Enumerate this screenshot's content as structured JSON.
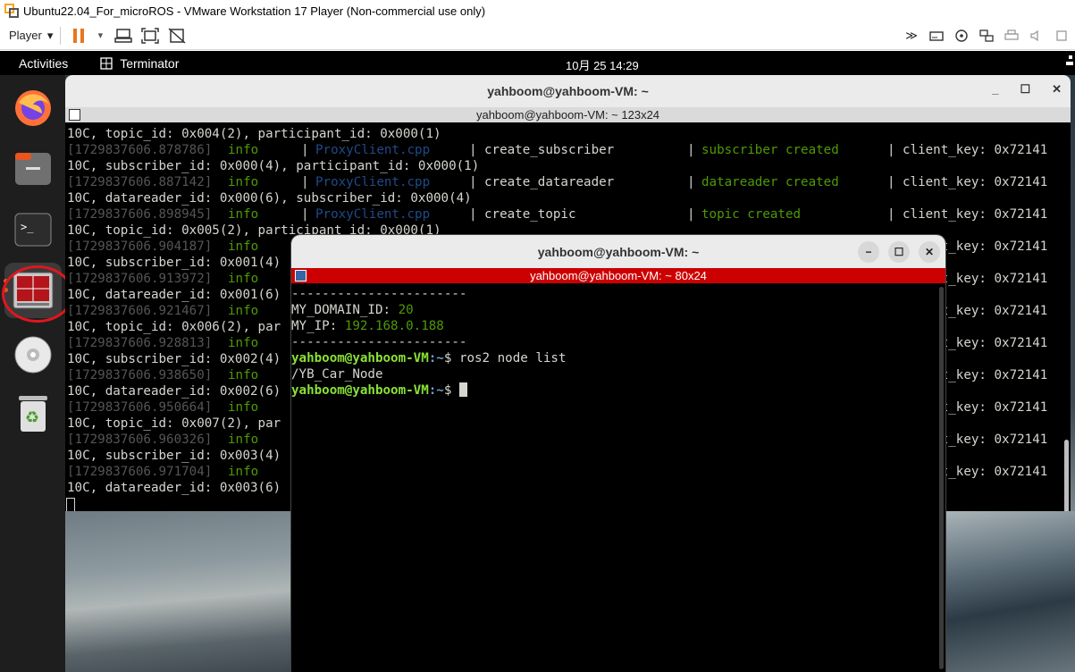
{
  "vmware": {
    "title": "Ubuntu22.04_For_microROS - VMware Workstation 17 Player (Non-commercial use only)",
    "player_label": "Player",
    "toolbar_icons": [
      "pause-icon",
      "chevron-down-icon",
      "send-ctrl-alt-del-icon",
      "fit-window-icon",
      "unity-icon"
    ],
    "tray_icons": [
      "forward-icon",
      "disk-icon",
      "cd-icon",
      "network-icon",
      "printer-icon",
      "audio-icon",
      "usb-icon"
    ]
  },
  "ubuntu_bar": {
    "activities": "Activities",
    "app_name": "Terminator",
    "clock": "10月 25  14:29"
  },
  "dock": {
    "items": [
      "firefox-icon",
      "files-icon",
      "terminal-icon",
      "terminator-icon",
      "cd-icon",
      "trash-icon"
    ],
    "active_item": "terminator-icon",
    "highlight_color": "#e0161e"
  },
  "big_terminal": {
    "title": "yahboom@yahboom-VM: ~",
    "subtitle": "yahboom@yahboom-VM: ~ 123x24",
    "controls": [
      "_",
      "☐",
      "✕"
    ],
    "lines": [
      {
        "text": "10C, topic_id: 0x004(2), participant_id: 0x000(1)"
      },
      {
        "ts": "[1729837606.878786]",
        "level": "info",
        "file": "ProxyClient.cpp",
        "func": "create_subscriber",
        "msg": "subscriber created",
        "key": "client_key: 0x72141"
      },
      {
        "text": "10C, subscriber_id: 0x000(4), participant_id: 0x000(1)"
      },
      {
        "ts": "[1729837606.887142]",
        "level": "info",
        "file": "ProxyClient.cpp",
        "func": "create_datareader",
        "msg": "datareader created",
        "key": "client_key: 0x72141"
      },
      {
        "text": "10C, datareader_id: 0x000(6), subscriber_id: 0x000(4)"
      },
      {
        "ts": "[1729837606.898945]",
        "level": "info",
        "file": "ProxyClient.cpp",
        "func": "create_topic",
        "msg": "topic created",
        "key": "client_key: 0x72141"
      },
      {
        "text": "10C, topic_id: 0x005(2), participant_id: 0x000(1)"
      },
      {
        "ts": "[1729837606.904187]",
        "level": "info",
        "key": "client_key: 0x72141"
      },
      {
        "text": "10C, subscriber_id: 0x001(4)"
      },
      {
        "ts": "[1729837606.913972]",
        "level": "info",
        "key": "client_key: 0x72141"
      },
      {
        "text": "10C, datareader_id: 0x001(6)"
      },
      {
        "ts": "[1729837606.921467]",
        "level": "info",
        "key": "client_key: 0x72141"
      },
      {
        "text": "10C, topic_id: 0x006(2), par"
      },
      {
        "ts": "[1729837606.928813]",
        "level": "info",
        "key": "client_key: 0x72141"
      },
      {
        "text": "10C, subscriber_id: 0x002(4)"
      },
      {
        "ts": "[1729837606.938650]",
        "level": "info",
        "key": "client_key: 0x72141"
      },
      {
        "text": "10C, datareader_id: 0x002(6)"
      },
      {
        "ts": "[1729837606.950664]",
        "level": "info",
        "key": "client_key: 0x72141"
      },
      {
        "text": "10C, topic_id: 0x007(2), par"
      },
      {
        "ts": "[1729837606.960326]",
        "level": "info",
        "key": "client_key: 0x72141"
      },
      {
        "text": "10C, subscriber_id: 0x003(4)"
      },
      {
        "ts": "[1729837606.971704]",
        "level": "info",
        "key": "client_key: 0x72141"
      },
      {
        "text": "10C, datareader_id: 0x003(6)"
      }
    ]
  },
  "small_terminal": {
    "title": "yahboom@yahboom-VM: ~",
    "subtitle": "yahboom@yahboom-VM: ~ 80x24",
    "separator": "-----------------------",
    "domain_label": "MY_DOMAIN_ID: ",
    "domain_value": "20",
    "ip_label": "MY_IP: ",
    "ip_value": "192.168.0.188",
    "prompt_user": "yahboom@yahboom-VM",
    "prompt_path": ":~",
    "prompt_symbol": "$ ",
    "command": "ros2 node list",
    "output": "/YB_Car_Node"
  }
}
